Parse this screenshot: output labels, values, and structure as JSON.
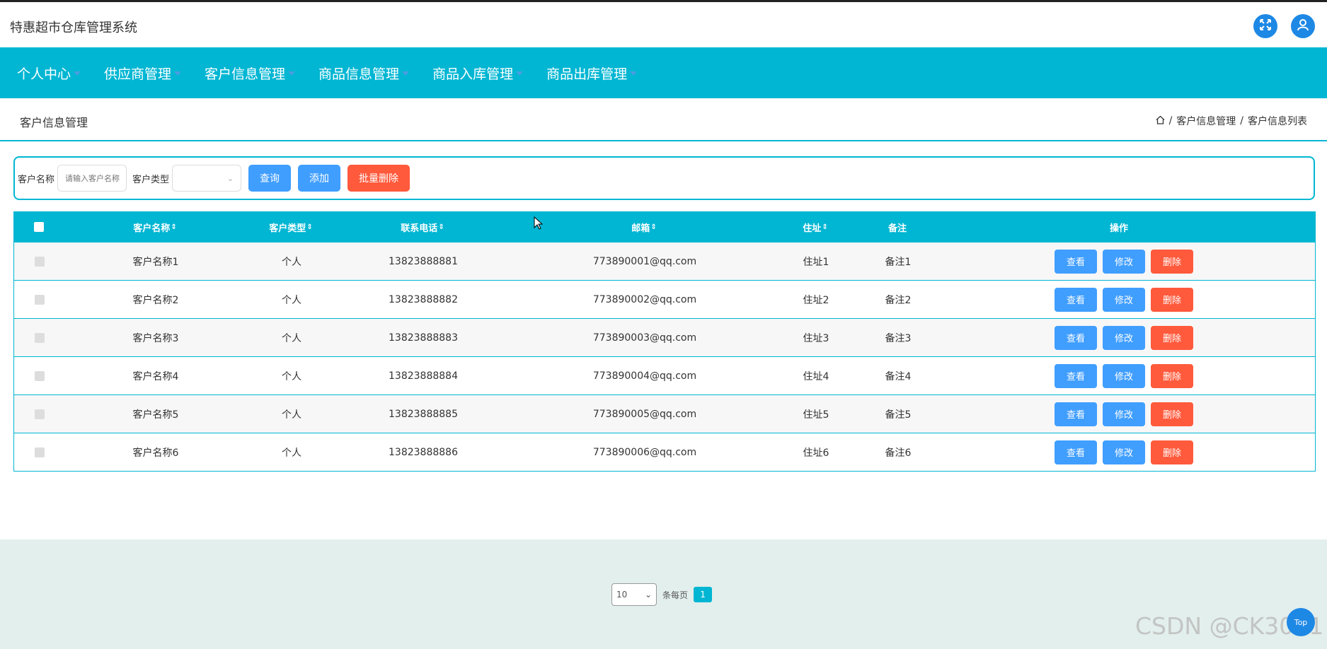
{
  "app": {
    "title": "特惠超市仓库管理系统"
  },
  "nav": [
    {
      "label": "个人中心"
    },
    {
      "label": "供应商管理"
    },
    {
      "label": "客户信息管理"
    },
    {
      "label": "商品信息管理"
    },
    {
      "label": "商品入库管理"
    },
    {
      "label": "商品出库管理"
    }
  ],
  "page": {
    "title": "客户信息管理",
    "breadcrumb": [
      "客户信息管理",
      "客户信息列表"
    ],
    "breadcrumb_sep": "/"
  },
  "search": {
    "name_label": "客户名称",
    "name_placeholder": "请输入客户名称",
    "type_label": "客户类型",
    "type_value": "",
    "query_button": "查询",
    "add_button": "添加",
    "batch_delete_button": "批量删除"
  },
  "table": {
    "headers": {
      "name": "客户名称",
      "type": "客户类型",
      "phone": "联系电话",
      "email": "邮箱",
      "address": "住址",
      "note": "备注",
      "actions": "操作"
    },
    "sort_icon": "⇕",
    "action_labels": {
      "view": "查看",
      "edit": "修改",
      "delete": "删除"
    },
    "rows": [
      {
        "name": "客户名称1",
        "type": "个人",
        "phone": "13823888881",
        "email": "773890001@qq.com",
        "address": "住址1",
        "note": "备注1"
      },
      {
        "name": "客户名称2",
        "type": "个人",
        "phone": "13823888882",
        "email": "773890002@qq.com",
        "address": "住址2",
        "note": "备注2"
      },
      {
        "name": "客户名称3",
        "type": "个人",
        "phone": "13823888883",
        "email": "773890003@qq.com",
        "address": "住址3",
        "note": "备注3"
      },
      {
        "name": "客户名称4",
        "type": "个人",
        "phone": "13823888884",
        "email": "773890004@qq.com",
        "address": "住址4",
        "note": "备注4"
      },
      {
        "name": "客户名称5",
        "type": "个人",
        "phone": "13823888885",
        "email": "773890005@qq.com",
        "address": "住址5",
        "note": "备注5"
      },
      {
        "name": "客户名称6",
        "type": "个人",
        "phone": "13823888886",
        "email": "773890006@qq.com",
        "address": "住址6",
        "note": "备注6"
      }
    ]
  },
  "pagination": {
    "page_size": "10",
    "per_page_label": "条每页",
    "current_page": "1"
  },
  "watermark": "CSDN @CK3011",
  "top_button": "Top",
  "colors": {
    "accent": "#00b6d3",
    "primary_button": "#409eff",
    "danger_button": "#ff5a3c",
    "icon_button": "#1e88e5",
    "footer_bg": "#e3efec"
  }
}
